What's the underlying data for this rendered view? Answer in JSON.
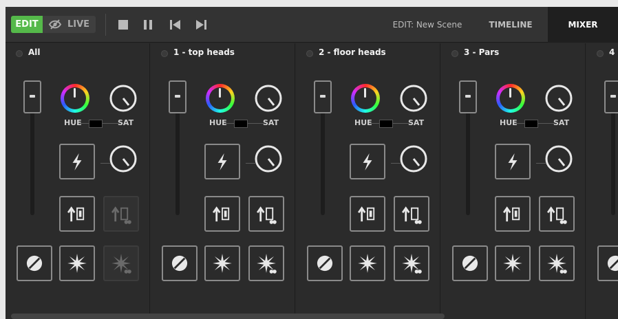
{
  "topbar": {
    "edit_label": "EDIT",
    "live_label": "LIVE",
    "tabs": [
      {
        "label": "EDIT: New Scene"
      },
      {
        "label": "TIMELINE"
      },
      {
        "label": "MIXER"
      }
    ],
    "active_tab": "MIXER",
    "transport_icons": [
      "stop-icon",
      "pause-icon",
      "skip-back-icon",
      "skip-forward-icon"
    ]
  },
  "channels": [
    {
      "name": "All"
    },
    {
      "name": "1 - top heads"
    },
    {
      "name": "2 - floor heads"
    },
    {
      "name": "3 - Pars"
    },
    {
      "name": "4"
    }
  ],
  "labels": {
    "hue": "HUE",
    "sat": "SAT"
  },
  "colors": {
    "accent": "#55b94a",
    "panel": "#2b2b2b",
    "topbar": "#333333",
    "active_tab": "#1f1f1f"
  }
}
